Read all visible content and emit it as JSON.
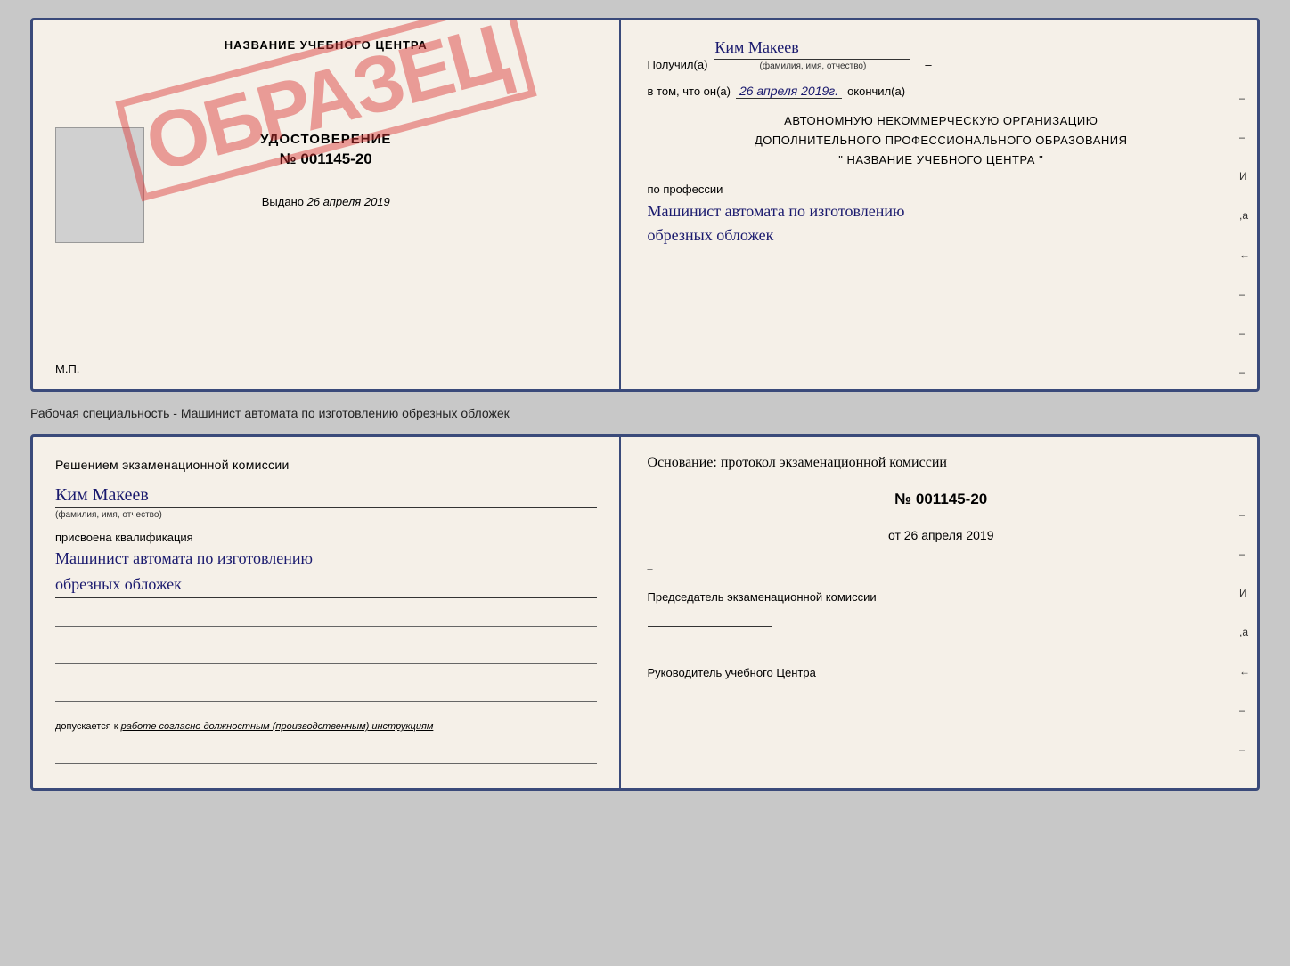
{
  "page": {
    "background": "#c8c8c8"
  },
  "certificate_top": {
    "left": {
      "title": "НАЗВАНИЕ УЧЕБНОГО ЦЕНТРА",
      "stamp_text": "ОБРАЗЕЦ",
      "udostoverenie_label": "УДОСТОВЕРЕНИЕ",
      "udostoverenie_num": "№ 001145-20",
      "vydano_label": "Выдано",
      "vydano_date": "26 апреля 2019",
      "mp_label": "М.П."
    },
    "right": {
      "poluchil_label": "Получил(а)",
      "receiver_name": "Ким Макеев",
      "fio_subtitle": "(фамилия, имя, отчество)",
      "dash": "–",
      "vtom_label": "в том, что он(а)",
      "date_value": "26 апреля 2019г.",
      "okonchil_label": "окончил(а)",
      "org_line1": "АВТОНОМНУЮ НЕКОММЕРЧЕСКУЮ ОРГАНИЗАЦИЮ",
      "org_line2": "ДОПОЛНИТЕЛЬНОГО ПРОФЕССИОНАЛЬНОГО ОБРАЗОВАНИЯ",
      "org_line3": "\"   НАЗВАНИЕ УЧЕБНОГО ЦЕНТРА   \"",
      "profession_label": "по профессии",
      "profession_value_line1": "Машинист автомата по изготовлению",
      "profession_value_line2": "обрезных обложек"
    }
  },
  "caption": {
    "text": "Рабочая специальность - Машинист автомата по изготовлению обрезных обложек"
  },
  "certificate_bottom": {
    "left": {
      "komissia_text": "Решением экзаменационной комиссии",
      "person_name": "Ким Макеев",
      "fio_label": "(фамилия, имя, отчество)",
      "prisvoena_label": "присвоена квалификация",
      "qualification_line1": "Машинист автомата по изготовлению",
      "qualification_line2": "обрезных обложек",
      "dopuskaetsya_prefix": "допускается к",
      "dopuskaetsya_text": "работе согласно должностным (производственным) инструкциям"
    },
    "right": {
      "osnovanie_text": "Основание: протокол экзаменационной комиссии",
      "protocol_num": "№ 001145-20",
      "protocol_ot_label": "от",
      "protocol_date": "26 апреля 2019",
      "predsedatel_label": "Председатель экзаменационной комиссии",
      "rukovoditel_label": "Руководитель учебного Центра"
    }
  },
  "right_markers": [
    "–",
    "–",
    "И",
    ",а",
    "←",
    "–",
    "–",
    "–",
    "–"
  ]
}
